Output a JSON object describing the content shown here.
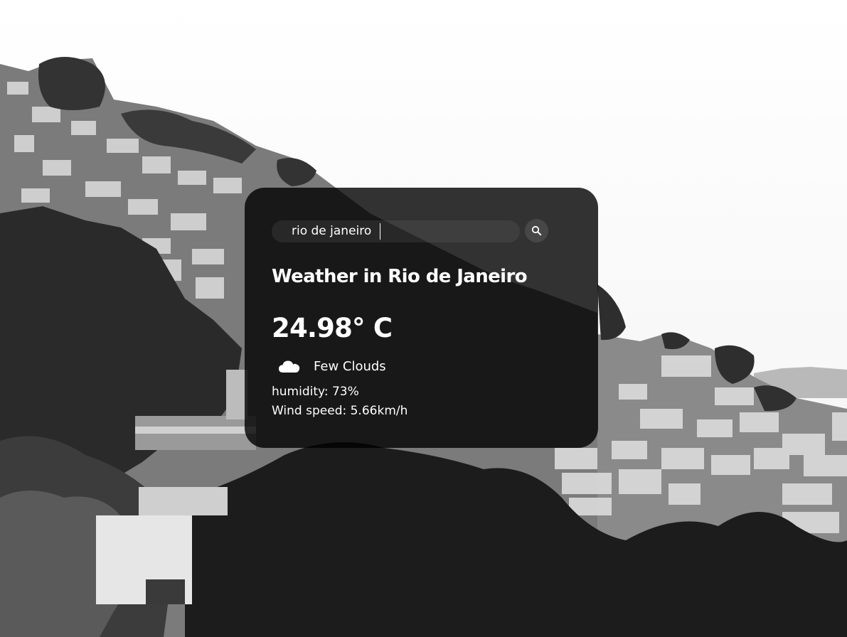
{
  "search": {
    "value": "rio de janeiro",
    "button_icon": "search-icon"
  },
  "weather": {
    "title": "Weather in Rio de Janeiro",
    "temperature": "24.98° C",
    "icon": "cloud-icon",
    "description": "Few Clouds",
    "humidity": "humidity: 73%",
    "wind": "Wind speed: 5.66km/h"
  },
  "colors": {
    "card_background": "#000000cc",
    "text": "#ffffff",
    "background": "#fafafa"
  }
}
